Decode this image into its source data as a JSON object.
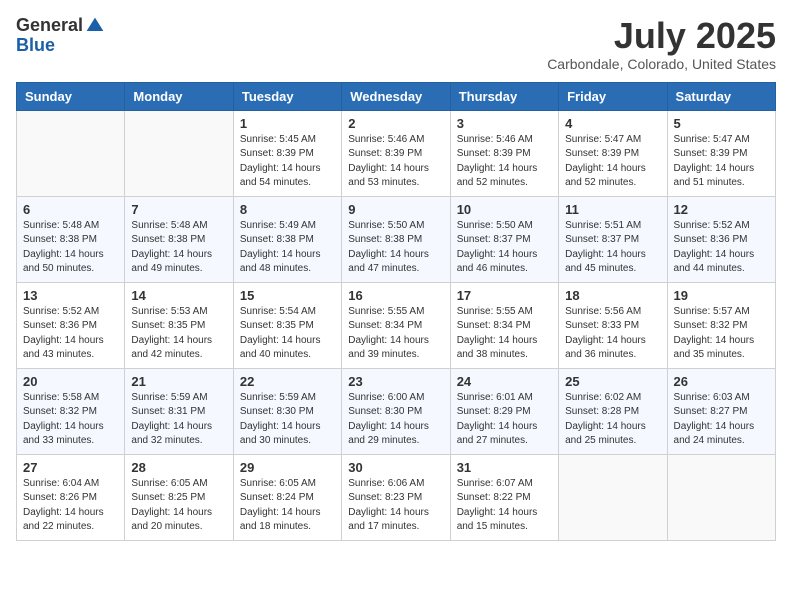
{
  "header": {
    "logo_general": "General",
    "logo_blue": "Blue",
    "month_title": "July 2025",
    "location": "Carbondale, Colorado, United States"
  },
  "weekdays": [
    "Sunday",
    "Monday",
    "Tuesday",
    "Wednesday",
    "Thursday",
    "Friday",
    "Saturday"
  ],
  "weeks": [
    [
      {
        "day": "",
        "info": ""
      },
      {
        "day": "",
        "info": ""
      },
      {
        "day": "1",
        "info": "Sunrise: 5:45 AM\nSunset: 8:39 PM\nDaylight: 14 hours and 54 minutes."
      },
      {
        "day": "2",
        "info": "Sunrise: 5:46 AM\nSunset: 8:39 PM\nDaylight: 14 hours and 53 minutes."
      },
      {
        "day": "3",
        "info": "Sunrise: 5:46 AM\nSunset: 8:39 PM\nDaylight: 14 hours and 52 minutes."
      },
      {
        "day": "4",
        "info": "Sunrise: 5:47 AM\nSunset: 8:39 PM\nDaylight: 14 hours and 52 minutes."
      },
      {
        "day": "5",
        "info": "Sunrise: 5:47 AM\nSunset: 8:39 PM\nDaylight: 14 hours and 51 minutes."
      }
    ],
    [
      {
        "day": "6",
        "info": "Sunrise: 5:48 AM\nSunset: 8:38 PM\nDaylight: 14 hours and 50 minutes."
      },
      {
        "day": "7",
        "info": "Sunrise: 5:48 AM\nSunset: 8:38 PM\nDaylight: 14 hours and 49 minutes."
      },
      {
        "day": "8",
        "info": "Sunrise: 5:49 AM\nSunset: 8:38 PM\nDaylight: 14 hours and 48 minutes."
      },
      {
        "day": "9",
        "info": "Sunrise: 5:50 AM\nSunset: 8:38 PM\nDaylight: 14 hours and 47 minutes."
      },
      {
        "day": "10",
        "info": "Sunrise: 5:50 AM\nSunset: 8:37 PM\nDaylight: 14 hours and 46 minutes."
      },
      {
        "day": "11",
        "info": "Sunrise: 5:51 AM\nSunset: 8:37 PM\nDaylight: 14 hours and 45 minutes."
      },
      {
        "day": "12",
        "info": "Sunrise: 5:52 AM\nSunset: 8:36 PM\nDaylight: 14 hours and 44 minutes."
      }
    ],
    [
      {
        "day": "13",
        "info": "Sunrise: 5:52 AM\nSunset: 8:36 PM\nDaylight: 14 hours and 43 minutes."
      },
      {
        "day": "14",
        "info": "Sunrise: 5:53 AM\nSunset: 8:35 PM\nDaylight: 14 hours and 42 minutes."
      },
      {
        "day": "15",
        "info": "Sunrise: 5:54 AM\nSunset: 8:35 PM\nDaylight: 14 hours and 40 minutes."
      },
      {
        "day": "16",
        "info": "Sunrise: 5:55 AM\nSunset: 8:34 PM\nDaylight: 14 hours and 39 minutes."
      },
      {
        "day": "17",
        "info": "Sunrise: 5:55 AM\nSunset: 8:34 PM\nDaylight: 14 hours and 38 minutes."
      },
      {
        "day": "18",
        "info": "Sunrise: 5:56 AM\nSunset: 8:33 PM\nDaylight: 14 hours and 36 minutes."
      },
      {
        "day": "19",
        "info": "Sunrise: 5:57 AM\nSunset: 8:32 PM\nDaylight: 14 hours and 35 minutes."
      }
    ],
    [
      {
        "day": "20",
        "info": "Sunrise: 5:58 AM\nSunset: 8:32 PM\nDaylight: 14 hours and 33 minutes."
      },
      {
        "day": "21",
        "info": "Sunrise: 5:59 AM\nSunset: 8:31 PM\nDaylight: 14 hours and 32 minutes."
      },
      {
        "day": "22",
        "info": "Sunrise: 5:59 AM\nSunset: 8:30 PM\nDaylight: 14 hours and 30 minutes."
      },
      {
        "day": "23",
        "info": "Sunrise: 6:00 AM\nSunset: 8:30 PM\nDaylight: 14 hours and 29 minutes."
      },
      {
        "day": "24",
        "info": "Sunrise: 6:01 AM\nSunset: 8:29 PM\nDaylight: 14 hours and 27 minutes."
      },
      {
        "day": "25",
        "info": "Sunrise: 6:02 AM\nSunset: 8:28 PM\nDaylight: 14 hours and 25 minutes."
      },
      {
        "day": "26",
        "info": "Sunrise: 6:03 AM\nSunset: 8:27 PM\nDaylight: 14 hours and 24 minutes."
      }
    ],
    [
      {
        "day": "27",
        "info": "Sunrise: 6:04 AM\nSunset: 8:26 PM\nDaylight: 14 hours and 22 minutes."
      },
      {
        "day": "28",
        "info": "Sunrise: 6:05 AM\nSunset: 8:25 PM\nDaylight: 14 hours and 20 minutes."
      },
      {
        "day": "29",
        "info": "Sunrise: 6:05 AM\nSunset: 8:24 PM\nDaylight: 14 hours and 18 minutes."
      },
      {
        "day": "30",
        "info": "Sunrise: 6:06 AM\nSunset: 8:23 PM\nDaylight: 14 hours and 17 minutes."
      },
      {
        "day": "31",
        "info": "Sunrise: 6:07 AM\nSunset: 8:22 PM\nDaylight: 14 hours and 15 minutes."
      },
      {
        "day": "",
        "info": ""
      },
      {
        "day": "",
        "info": ""
      }
    ]
  ]
}
